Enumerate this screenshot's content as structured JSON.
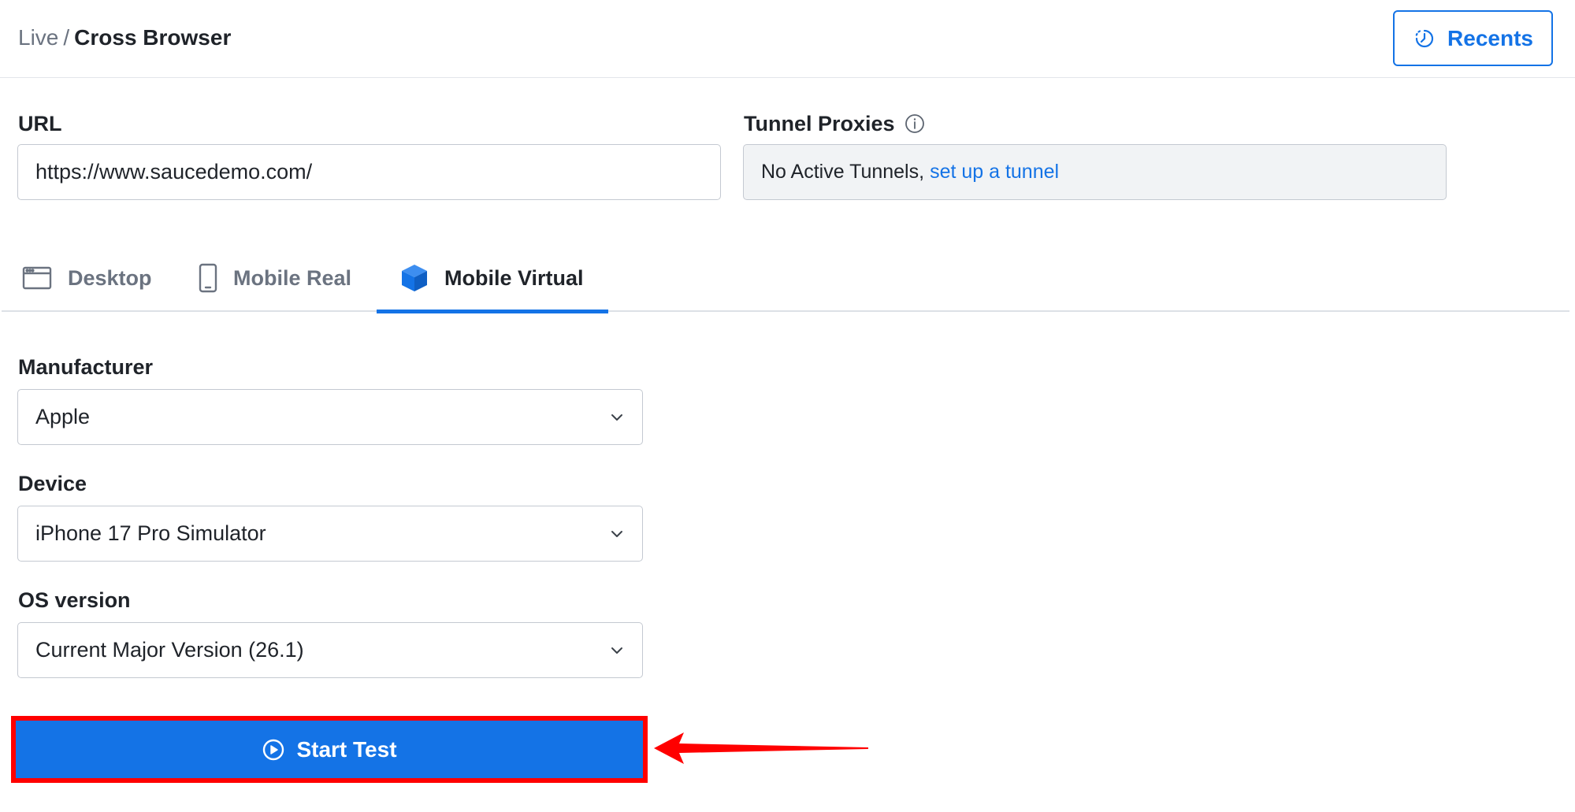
{
  "header": {
    "breadcrumb": {
      "parent": "Live",
      "separator": "/",
      "current": "Cross Browser"
    },
    "recents_label": "Recents",
    "recents_icon": "history-clock-icon"
  },
  "form": {
    "url": {
      "label": "URL",
      "value": "https://www.saucedemo.com/"
    },
    "tunnel": {
      "label": "Tunnel Proxies",
      "info_icon": "info-icon",
      "status_text": "No Active Tunnels,",
      "link_text": "set up a tunnel"
    }
  },
  "tabs": [
    {
      "label": "Desktop",
      "icon": "browser-window-icon",
      "active": false
    },
    {
      "label": "Mobile Real",
      "icon": "smartphone-icon",
      "active": false
    },
    {
      "label": "Mobile Virtual",
      "icon": "cube-icon",
      "active": true
    }
  ],
  "selects": {
    "manufacturer": {
      "label": "Manufacturer",
      "value": "Apple"
    },
    "device": {
      "label": "Device",
      "value": "iPhone 17 Pro Simulator"
    },
    "os_version": {
      "label": "OS version",
      "value": "Current Major Version (26.1)"
    }
  },
  "start_test": {
    "label": "Start Test",
    "icon": "play-circle-icon"
  },
  "colors": {
    "accent": "#1473e6",
    "highlight": "#ff0000",
    "text": "#1f2329",
    "muted": "#6b7380"
  }
}
